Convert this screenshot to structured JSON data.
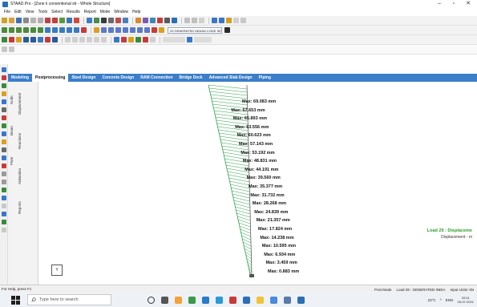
{
  "window": {
    "title": "STAAD.Pro - [Zone ii conventional str - Whole Structure]",
    "controls": [
      "–",
      "▫",
      "✕"
    ]
  },
  "menu": [
    "File",
    "Edit",
    "View",
    "Tools",
    "Select",
    "Results",
    "Report",
    "Mode",
    "Window",
    "Help"
  ],
  "toolbar": {
    "design_code": "29 GENERATED INDIAN CODE SE"
  },
  "tabs": [
    {
      "label": "Modeling",
      "active": false
    },
    {
      "label": "Postprocessing",
      "active": true
    },
    {
      "label": "Steel Design",
      "active": false
    },
    {
      "label": "Concrete Design",
      "active": false
    },
    {
      "label": "RAM Connection",
      "active": false
    },
    {
      "label": "Bridge Deck",
      "active": false
    },
    {
      "label": "Advanced Slab Design",
      "active": false
    },
    {
      "label": "Piping",
      "active": false
    }
  ],
  "side_tabs": {
    "group1": [
      "Node",
      "Beam",
      "Plate"
    ],
    "group2": [
      "Displacement",
      "Reactions",
      "Animation",
      "Reports"
    ]
  },
  "max_labels": [
    "Max: 69.083 mm",
    "Max: 67.653 mm",
    "Max: 65.893 mm",
    "Max: 63.556 mm",
    "Max: 60.623 mm",
    "Max: 57.143 mm",
    "Max: 53.192 mm",
    "Max: 48.831 mm",
    "Max: 44.191 mm",
    "Max: 39.560 mm",
    "Max: 35.377 mm",
    "Max: 31.732 mm",
    "Max: 28.268 mm",
    "Max: 24.839 mm",
    "Max: 21.357 mm",
    "Max: 17.824 mm",
    "Max: 14.238 mm",
    "Max: 10.595 mm",
    "Max: 6.934 mm",
    "Max: 3.459 mm",
    "Max: 0.883 mm"
  ],
  "load_case": {
    "title": "Load 29 : Displaceme",
    "subtitle": "Displacement - m"
  },
  "axes_label": "Y",
  "status": {
    "help": "For Help, press F1",
    "mode": "Post Mode",
    "load": "Load 29 : GENERATED INDIA",
    "units": "Input Units: kN"
  },
  "taskbar": {
    "search_placeholder": "Type here to search",
    "weather": "23°C",
    "lang": "ENG",
    "time": "22:01",
    "date": "25-07-2021"
  },
  "colors": {
    "accent": "#3b7ec9",
    "diagram_line": "#2fa14a",
    "load_title": "#2aa12a"
  }
}
